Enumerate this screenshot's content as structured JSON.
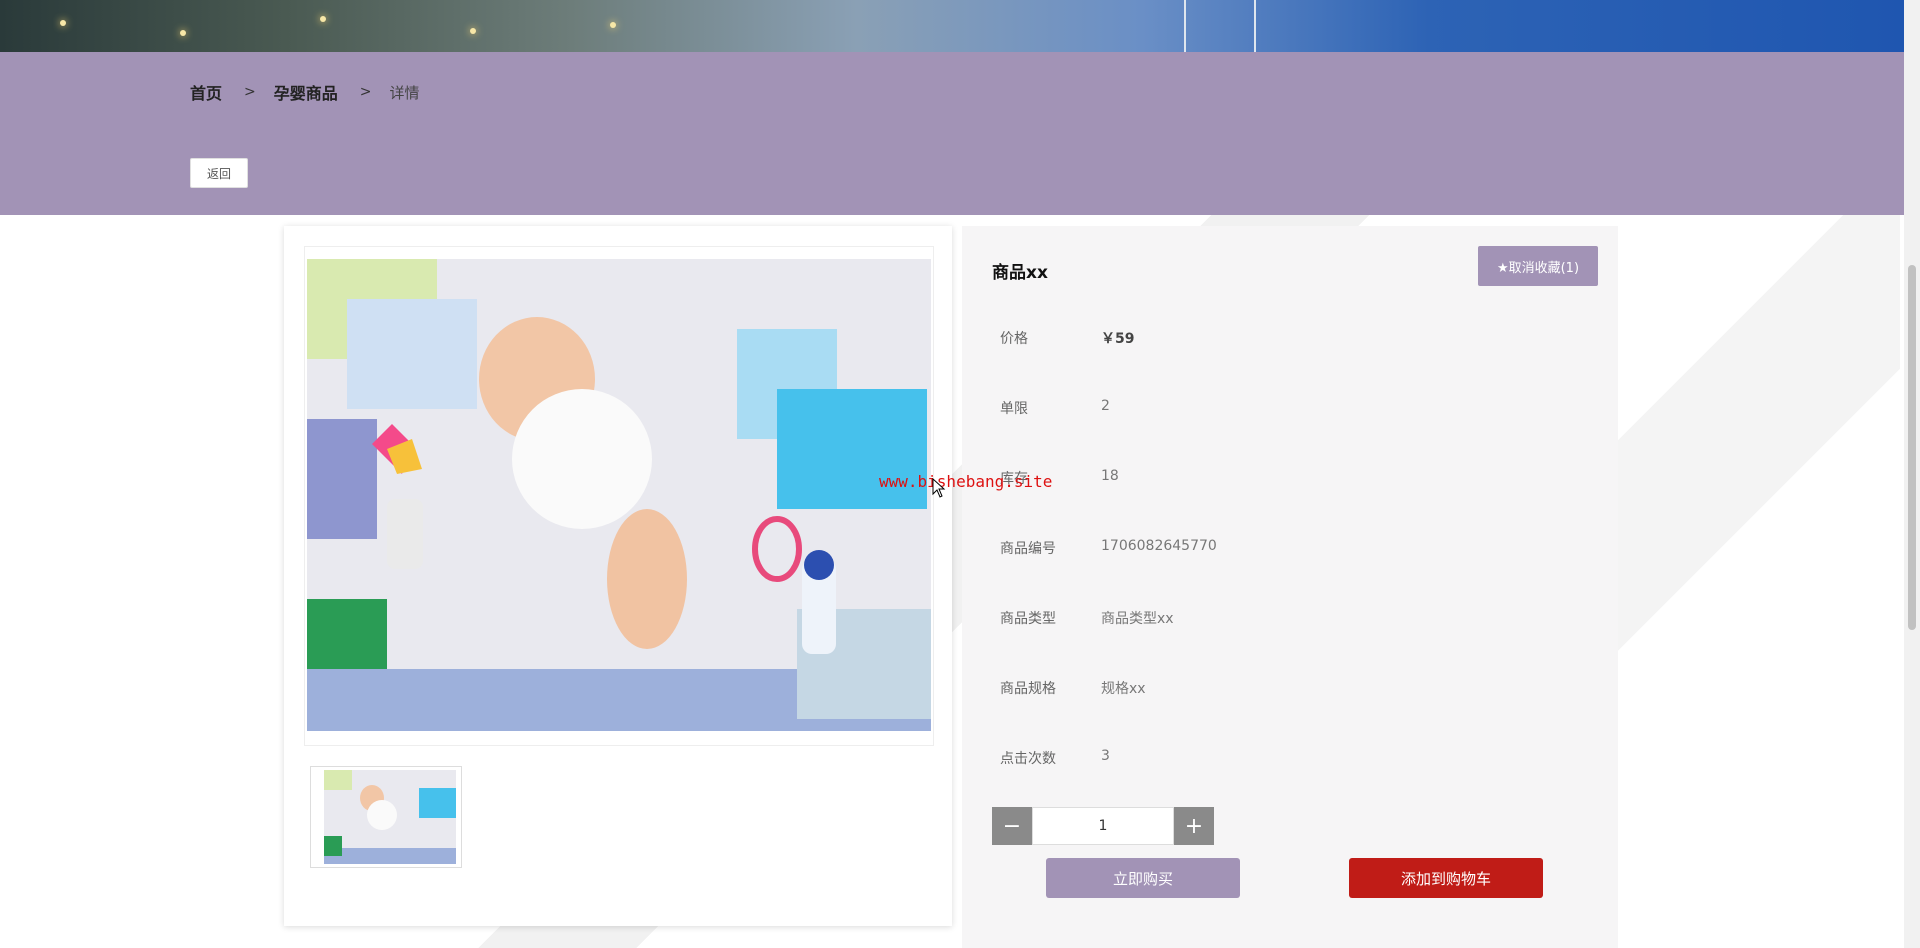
{
  "breadcrumb": {
    "home": "首页",
    "sep1": ">",
    "category": "孕婴商品",
    "sep2": ">",
    "current": "详情"
  },
  "back_label": "返回",
  "product": {
    "title": "商品xx",
    "favorite_label": "★取消收藏(1)",
    "rows": [
      {
        "label": "价格",
        "value": "￥59"
      },
      {
        "label": "单限",
        "value": "2"
      },
      {
        "label": "库存",
        "value": "18"
      },
      {
        "label": "商品编号",
        "value": "1706082645770"
      },
      {
        "label": "商品类型",
        "value": "商品类型xx"
      },
      {
        "label": "商品规格",
        "value": "规格xx"
      },
      {
        "label": "点击次数",
        "value": "3"
      }
    ],
    "quantity": "1",
    "minus": "−",
    "plus": "+",
    "buy_now": "立即购买",
    "add_to_cart": "添加到购物车"
  },
  "watermark": "www.bishebang.site",
  "colors": {
    "band": "#a293b6",
    "accent": "#a293b6",
    "cart": "#c01c17"
  }
}
